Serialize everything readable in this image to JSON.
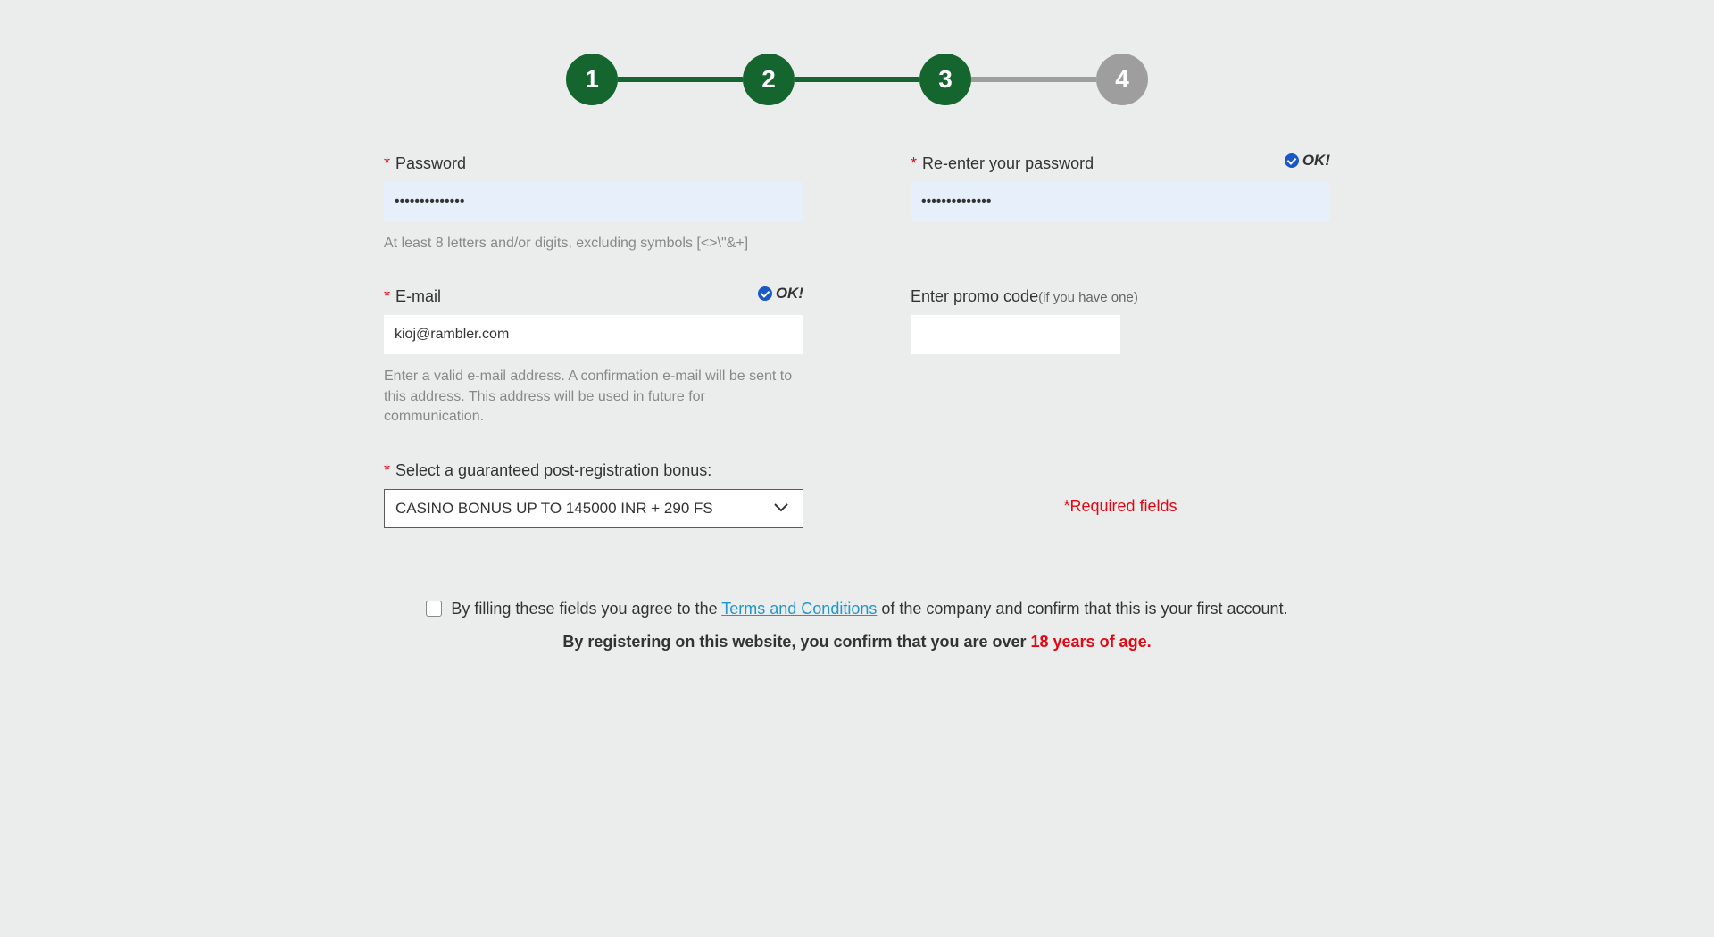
{
  "stepper": {
    "steps": [
      "1",
      "2",
      "3",
      "4"
    ],
    "current": 3
  },
  "fields": {
    "password": {
      "label": "Password",
      "value": "••••••••••••••",
      "hint": "At least 8 letters and/or digits, excluding symbols [<>\\\"&+]"
    },
    "repassword": {
      "label": "Re-enter your password",
      "value": "••••••••••••••",
      "ok": "OK!"
    },
    "email": {
      "label": "E-mail",
      "value": "kioj@rambler.com",
      "ok": "OK!",
      "hint": "Enter a valid e-mail address. A confirmation e-mail will be sent to this address. This address will be used in future for communication."
    },
    "promo": {
      "label": "Enter promo code",
      "suffix": "(if you have one)",
      "value": ""
    },
    "bonus": {
      "label": "Select a guaranteed post-registration bonus:",
      "value": "CASINO BONUS UP TO 145000 INR + 290 FS"
    }
  },
  "required_note": "*Required fields",
  "legal": {
    "prefix": "By filling these fields you agree to the ",
    "terms": "Terms and Conditions",
    "suffix": " of the company and confirm that this is your first account.",
    "line2_prefix": "By registering on this website, you confirm that you are over ",
    "age": "18 years of age."
  }
}
